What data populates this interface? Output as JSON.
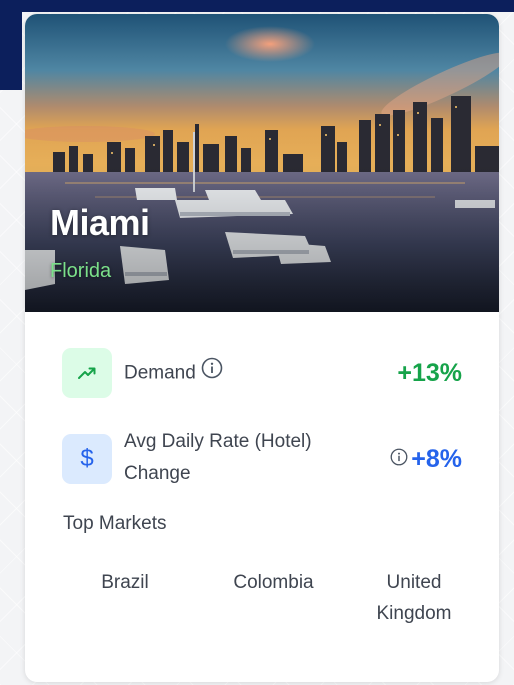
{
  "destination": {
    "city": "Miami",
    "state": "Florida"
  },
  "metrics": [
    {
      "label": "Demand",
      "value": "+13%",
      "icon": "trend-up-icon",
      "color": "#16a34a"
    },
    {
      "label": "Avg Daily Rate (Hotel) Change",
      "value": "+8%",
      "icon": "dollar-icon",
      "color": "#2563eb"
    }
  ],
  "top_markets": {
    "label": "Top Markets",
    "items": [
      "Brazil",
      "Colombia",
      "United Kingdom"
    ]
  },
  "colors": {
    "accent_green": "#16a34a",
    "accent_blue": "#2563eb",
    "state_text": "#7be08a"
  }
}
